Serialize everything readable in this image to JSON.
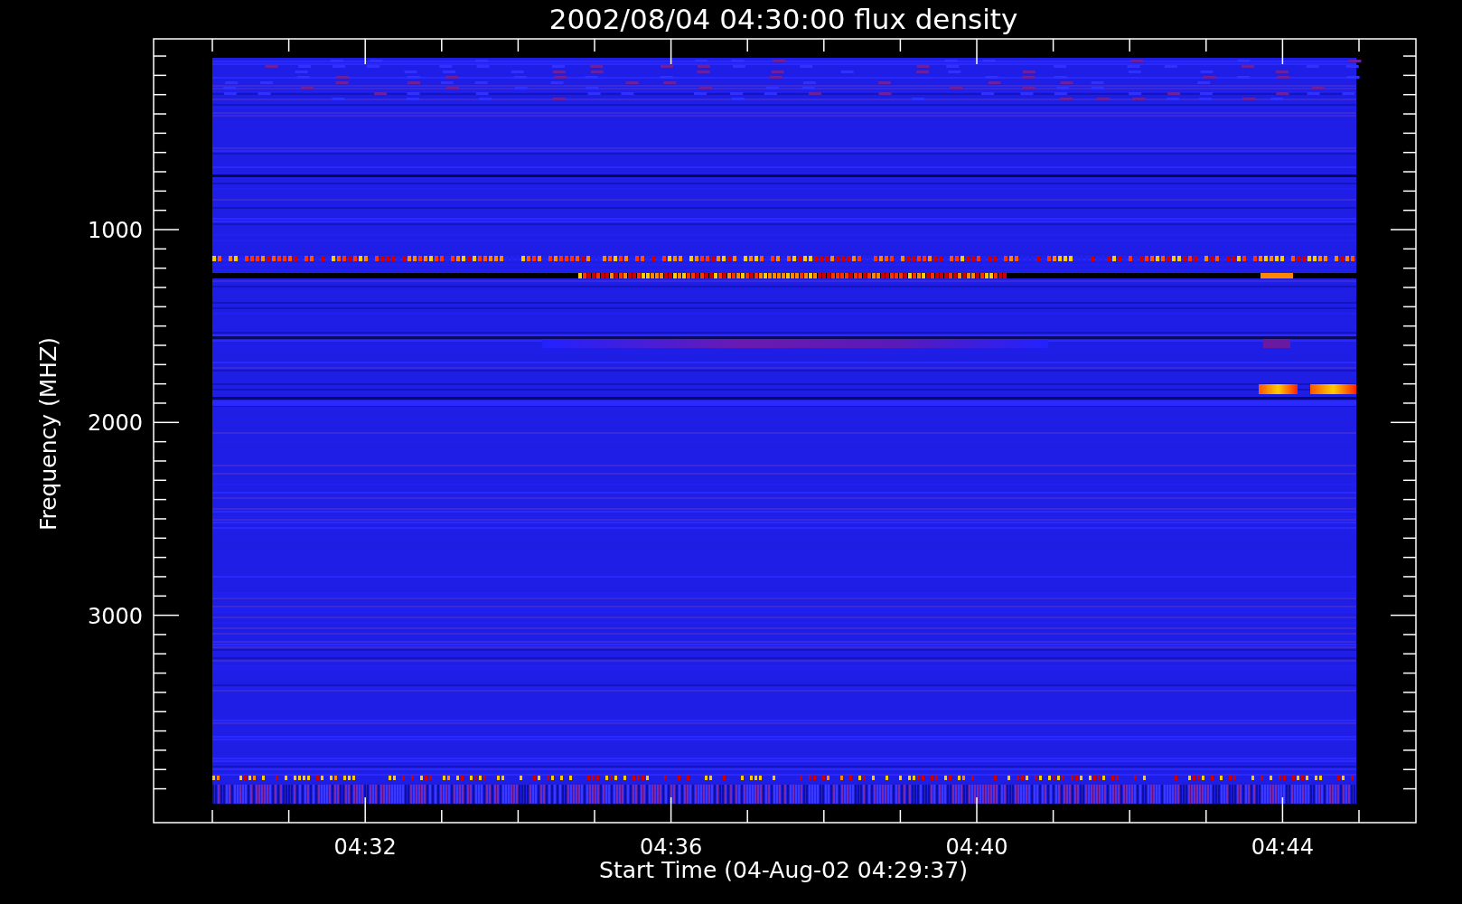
{
  "title": "2002/08/04 04:30:00 flux density",
  "y_axis": {
    "label": "Frequency (MHZ)",
    "ticks": [
      "1000",
      "2000",
      "3000"
    ]
  },
  "x_axis": {
    "label": "Start Time (04-Aug-02 04:29:37)",
    "ticks": [
      "04:32",
      "04:36",
      "04:40",
      "04:44"
    ]
  }
}
